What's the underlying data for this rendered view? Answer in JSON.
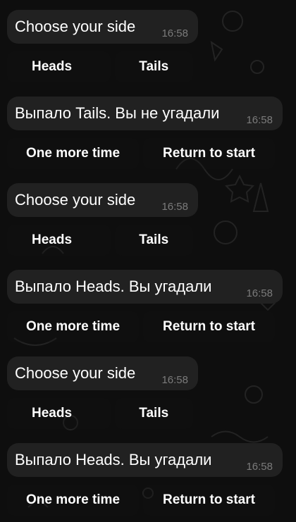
{
  "colors": {
    "background": "#0e0e0e",
    "bubble": "#212121",
    "message_text": "#ffffff",
    "timestamp": "#7b7b7b"
  },
  "messages": [
    {
      "text": "Choose your side",
      "time": "16:58",
      "buttons": [
        "Heads",
        "Tails"
      ]
    },
    {
      "text": "Выпало Tails. Вы не угадали",
      "time": "16:58",
      "buttons": [
        "One more time",
        "Return to start"
      ]
    },
    {
      "text": "Choose your side",
      "time": "16:58",
      "buttons": [
        "Heads",
        "Tails"
      ]
    },
    {
      "text": "Выпало Heads. Вы угадали",
      "time": "16:58",
      "buttons": [
        "One more time",
        "Return to start"
      ]
    },
    {
      "text": "Choose your side",
      "time": "16:58",
      "buttons": [
        "Heads",
        "Tails"
      ]
    },
    {
      "text": "Выпало Heads. Вы угадали",
      "time": "16:58",
      "buttons": [
        "One more time",
        "Return to start"
      ]
    }
  ]
}
